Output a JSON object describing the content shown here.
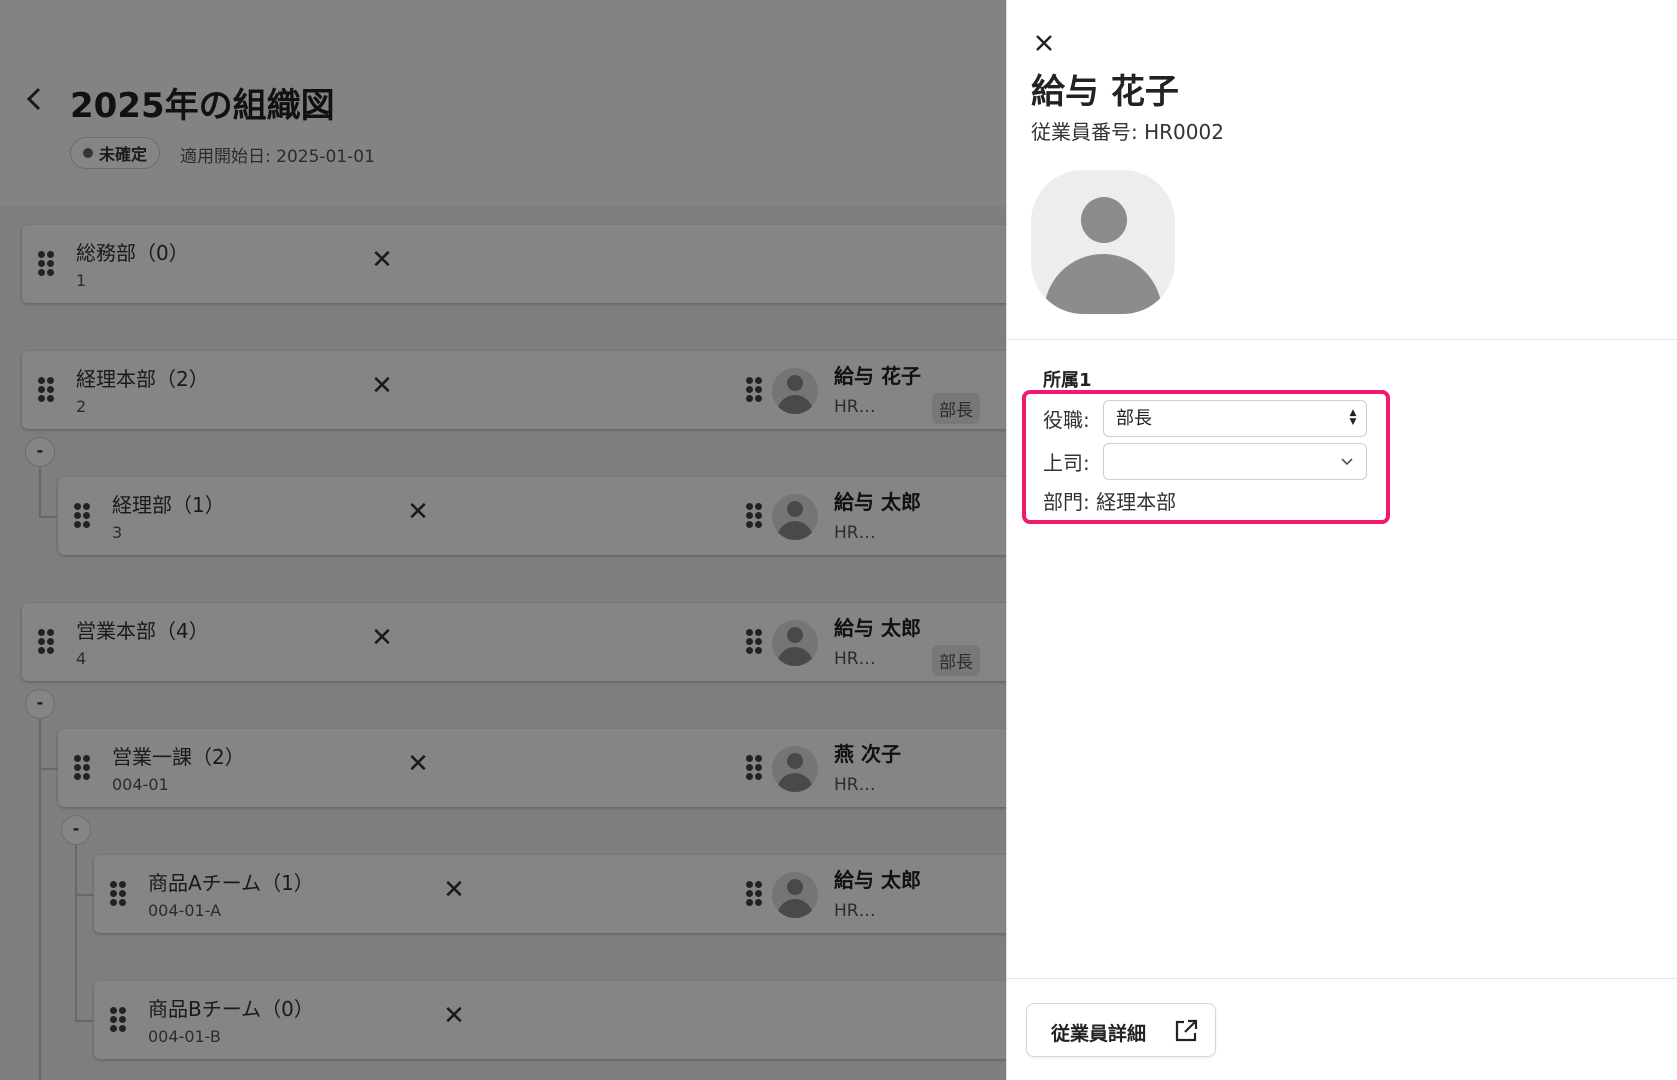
{
  "header": {
    "title": "2025年の組織図",
    "status": "未確定",
    "start_date": "適用開始日: 2025-01-01"
  },
  "departments": [
    {
      "name": "総務部（0）",
      "code": "1",
      "members": []
    },
    {
      "name": "経理本部（2）",
      "code": "2",
      "members": [
        {
          "name": "給与 花子",
          "code": "HR…",
          "role": "部長"
        }
      ]
    },
    {
      "name": "経理部（1）",
      "code": "3",
      "members": [
        {
          "name": "給与 太郎",
          "code": "HR…",
          "role": ""
        }
      ]
    },
    {
      "name": "営業本部（4）",
      "code": "4",
      "members": [
        {
          "name": "給与 太郎",
          "code": "HR…",
          "role": "部長"
        }
      ]
    },
    {
      "name": "営業一課（2）",
      "code": "004-01",
      "members": [
        {
          "name": "燕 次子",
          "code": "HR…",
          "role": ""
        }
      ]
    },
    {
      "name": "商品Aチーム（1）",
      "code": "004-01-A",
      "members": [
        {
          "name": "給与 太郎",
          "code": "HR…",
          "role": ""
        }
      ]
    },
    {
      "name": "商品Bチーム（0）",
      "code": "004-01-B",
      "members": []
    }
  ],
  "toggles": {
    "collapse_label": "-"
  },
  "icons": {
    "back": "chevron-left-icon",
    "remove": "close-icon",
    "drag": "drag-handle-icon",
    "avatar": "person-icon",
    "external": "external-link-icon"
  },
  "panel": {
    "employee_name": "給与 花子",
    "employee_number": "従業員番号: HR0002",
    "assignment_title": "所属1",
    "position_label": "役職:",
    "position_value": "部長",
    "supervisor_label": "上司:",
    "supervisor_value": "",
    "department_text": "部門: 経理本部",
    "detail_button": "従業員詳細"
  },
  "colors": {
    "highlight": "#f0196f",
    "overlay": "rgba(0,0,0,0.48)",
    "avatar_gray": "#8c8c8c"
  }
}
